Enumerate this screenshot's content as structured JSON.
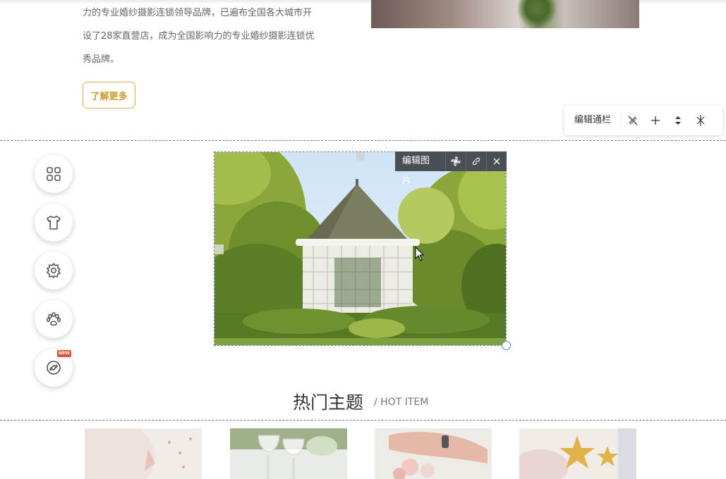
{
  "intro": {
    "lines": [
      "力的专业婚纱摄影连锁领导品牌，已遍布全国各大城市开",
      "设了28家直营店，成为全国影响力的专业婚纱摄影连锁优",
      "秀品牌。"
    ],
    "learn_more": "了解更多"
  },
  "banner_toolbar": {
    "label": "编辑通栏",
    "buttons": [
      "unlink-icon",
      "plus-icon",
      "move-updown-icon",
      "split-icon"
    ]
  },
  "side_toolbar": {
    "items": [
      "apps-grid-icon",
      "tshirt-icon",
      "gear-icon",
      "paw-icon",
      "link-circle-icon"
    ],
    "badge": "NEW"
  },
  "image_toolbar": {
    "label": "编辑图片",
    "buttons": [
      "pinwheel-icon",
      "link-icon",
      "close-icon"
    ]
  },
  "section": {
    "title": "热门主题",
    "subtitle": "/ HOT ITEM"
  },
  "colors": {
    "accent": "#c99a2a",
    "selection": "#5a86c7",
    "toolbar_dark": "#4a4e55",
    "badge": "#e2533a"
  }
}
